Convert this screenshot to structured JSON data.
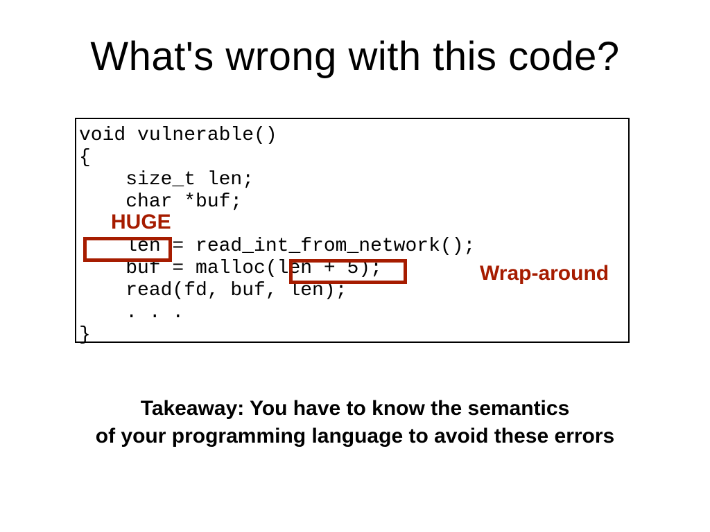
{
  "title": "What's wrong with this code?",
  "code": "void vulnerable()\n{\n    size_t len;\n    char *buf;\n\n    len = read_int_from_network();\n    buf = malloc(len + 5);\n    read(fd, buf, len);\n    . . .\n}",
  "annotations": {
    "huge": "HUGE",
    "wrap": "Wrap-around"
  },
  "takeaway_line1": "Takeaway: You have to know the semantics",
  "takeaway_line2": "of your programming language to avoid these errors"
}
